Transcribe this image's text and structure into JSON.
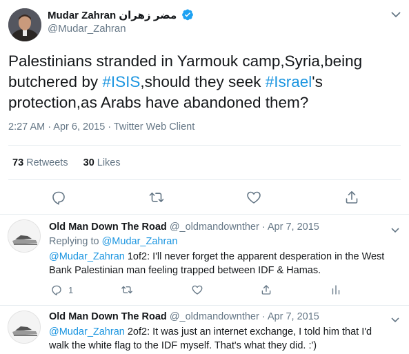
{
  "tweet": {
    "author_name": "Mudar Zahran مضر زهران",
    "handle": "@Mudar_Zahran",
    "text_before_1": "Palestinians stranded in Yarmouk camp,Syria,being",
    "text_before_2": "butchered by ",
    "hashtag_isis": "#ISIS",
    "text_mid_2": ",should they seek ",
    "hashtag_israel": "#Israel",
    "text_after_2": "'s",
    "text_line_3": "protection,as Arabs have abandoned them?",
    "timestamp": "2:27 AM · Apr 6, 2015 · Twitter Web Client",
    "retweets_count": "73",
    "retweets_label": "Retweets",
    "likes_count": "30",
    "likes_label": "Likes"
  },
  "replies": [
    {
      "name": "Old Man Down The Road",
      "handle_date": "@_oldmandownther · Apr 7, 2015",
      "replying_prefix": "Replying to ",
      "replying_to": "@Mudar_Zahran",
      "mention": "@Mudar_Zahran",
      "text_1": " 1of2: I'll never forget the apparent desperation in the West",
      "text_2": "Bank Palestinian man feeling trapped between IDF & Hamas.",
      "reply_count": "1"
    },
    {
      "name": "Old Man Down The Road",
      "handle_date": "@_oldmandownther · Apr 7, 2015",
      "mention": "@Mudar_Zahran",
      "text_1": " 2of2: It was just an internet exchange, I told him that I'd",
      "text_2": "walk the white flag to the IDF myself. That's what they did. :')"
    }
  ],
  "icons": {
    "reply": "reply-icon",
    "retweet": "retweet-icon",
    "like": "heart-icon",
    "share": "share-icon",
    "analytics": "analytics-icon",
    "verified": "verified-badge-icon",
    "more": "chevron-down-icon"
  },
  "colors": {
    "link": "#1b95e0",
    "muted": "#657786",
    "verified": "#1da1f2",
    "divider": "#e6ecf0"
  }
}
